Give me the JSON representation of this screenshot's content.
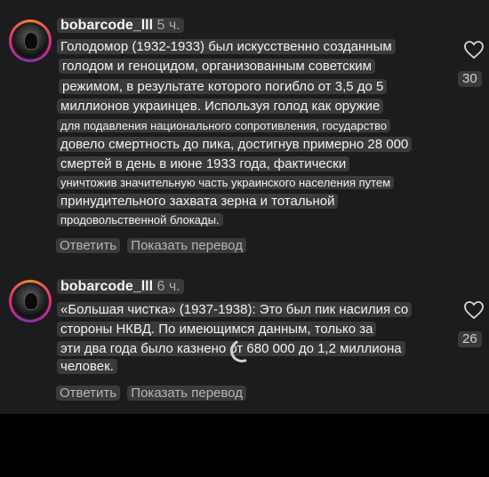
{
  "comments": [
    {
      "username": "bobarcode_lll",
      "time": "5 ч.",
      "lines": [
        "Голодомор (1932-1933) был искусственно созданным",
        "голодом и геноцидом, организованным советским",
        "режимом, в результате которого погибло от 3,5 до 5",
        "миллионов украинцев. Используя голод как оружие",
        "для подавления национального сопротивления, государство",
        "довело смертность до пика, достигнув примерно 28 000",
        "смертей в день в июне 1933 года, фактически",
        "уничтожив значительную часть украинского населения путем",
        "принудительного захвата зерна и тотальной",
        "продовольственной блокады."
      ],
      "reply_label": "Ответить",
      "translate_label": "Показать перевод",
      "likes": "30"
    },
    {
      "username": "bobarcode_lll",
      "time": "6 ч.",
      "lines": [
        "«Большая чистка» (1937-1938): Это был пик насилия со",
        "стороны НКВД. По имеющимся данным, только за",
        "эти два года было казнено от 680 000 до 1,2 миллиона",
        "человек."
      ],
      "reply_label": "Ответить",
      "translate_label": "Показать перевод",
      "likes": "26"
    }
  ]
}
